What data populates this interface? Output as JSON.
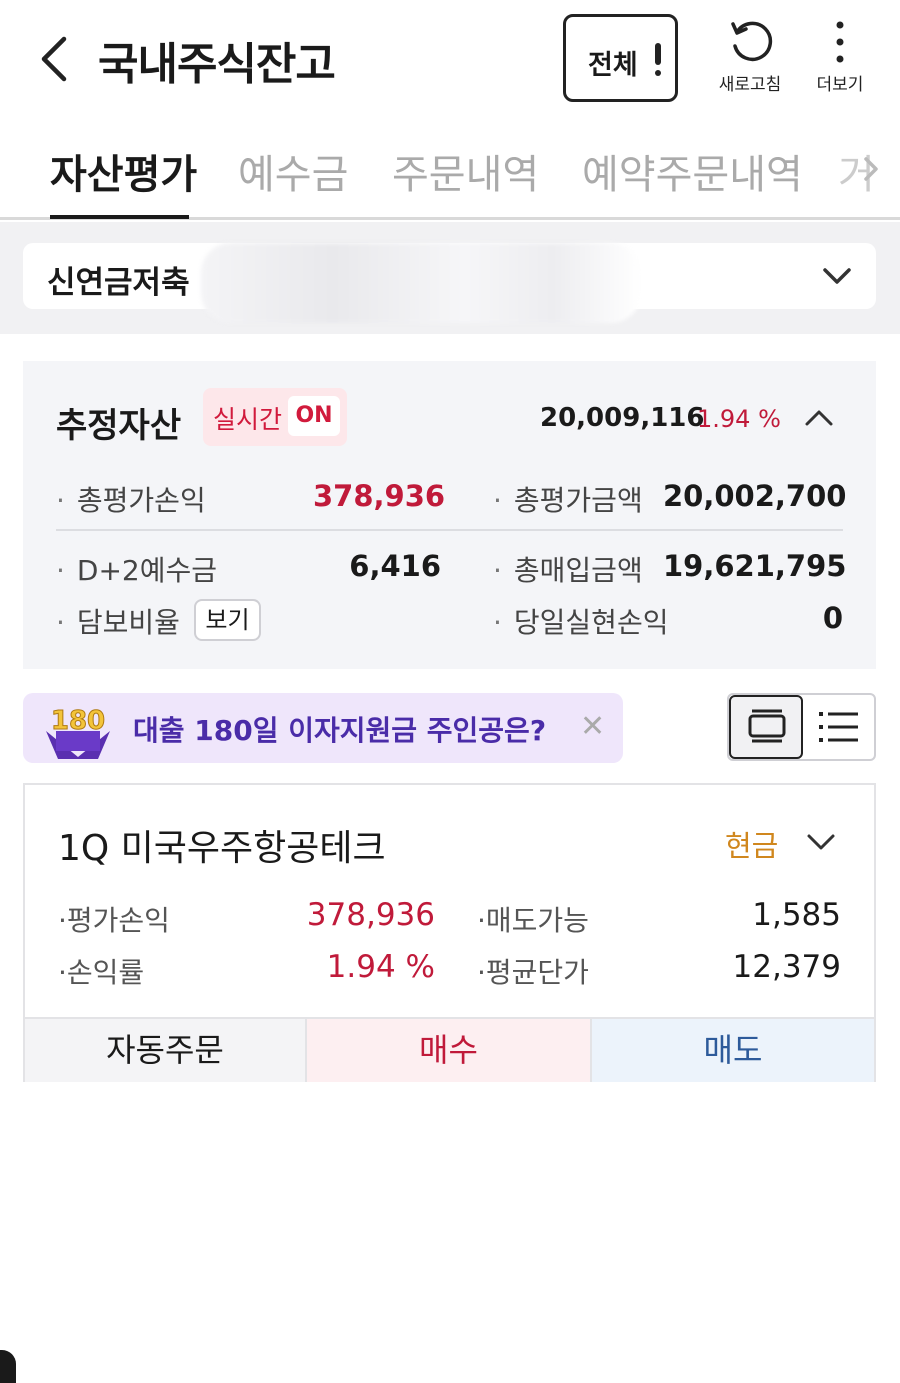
{
  "header": {
    "title": "국내주식잔고",
    "all_button": "전체",
    "refresh_label": "새로고침",
    "more_label": "더보기"
  },
  "tabs": [
    {
      "label": "자산평가",
      "active": true
    },
    {
      "label": "예수금",
      "active": false
    },
    {
      "label": "주문내역",
      "active": false
    },
    {
      "label": "예약주문내역",
      "active": false
    },
    {
      "label": "거",
      "active": false
    }
  ],
  "account": {
    "name": "신연금저축"
  },
  "asset": {
    "title": "추정자산",
    "realtime_label": "실시간",
    "realtime_state": "ON",
    "total": "20,009,116",
    "rate": "1.94 %",
    "stats": [
      {
        "label": "총평가손익",
        "value": "378,936",
        "color": "red"
      },
      {
        "label": "총평가금액",
        "value": "20,002,700",
        "color": "default"
      },
      {
        "label": "D+2예수금",
        "value": "6,416",
        "color": "default"
      },
      {
        "label": "총매입금액",
        "value": "19,621,795",
        "color": "default"
      },
      {
        "label": "담보비율",
        "value": "",
        "color": "default"
      },
      {
        "label": "당일실현손익",
        "value": "0",
        "color": "default"
      }
    ],
    "view_button": "보기"
  },
  "banner": {
    "badge_text": "180",
    "text": "대출 180일 이자지원금 주인공은?",
    "close": "✕"
  },
  "holding": {
    "name": "1Q 미국우주항공테크",
    "type": "현금",
    "stats": [
      {
        "label": "평가손익",
        "value": "378,936"
      },
      {
        "label": "매도가능",
        "value": "1,585"
      },
      {
        "label": "손익률",
        "value": "1.94 %"
      },
      {
        "label": "평균단가",
        "value": "12,379"
      }
    ],
    "actions": {
      "auto": "자동주문",
      "buy": "매수",
      "sell": "매도"
    }
  },
  "colors": {
    "accent_red": "#c01a3a",
    "accent_blue": "#2d5a9a",
    "cash_orange": "#d0871e",
    "banner_purple": "#4a2ca8"
  }
}
